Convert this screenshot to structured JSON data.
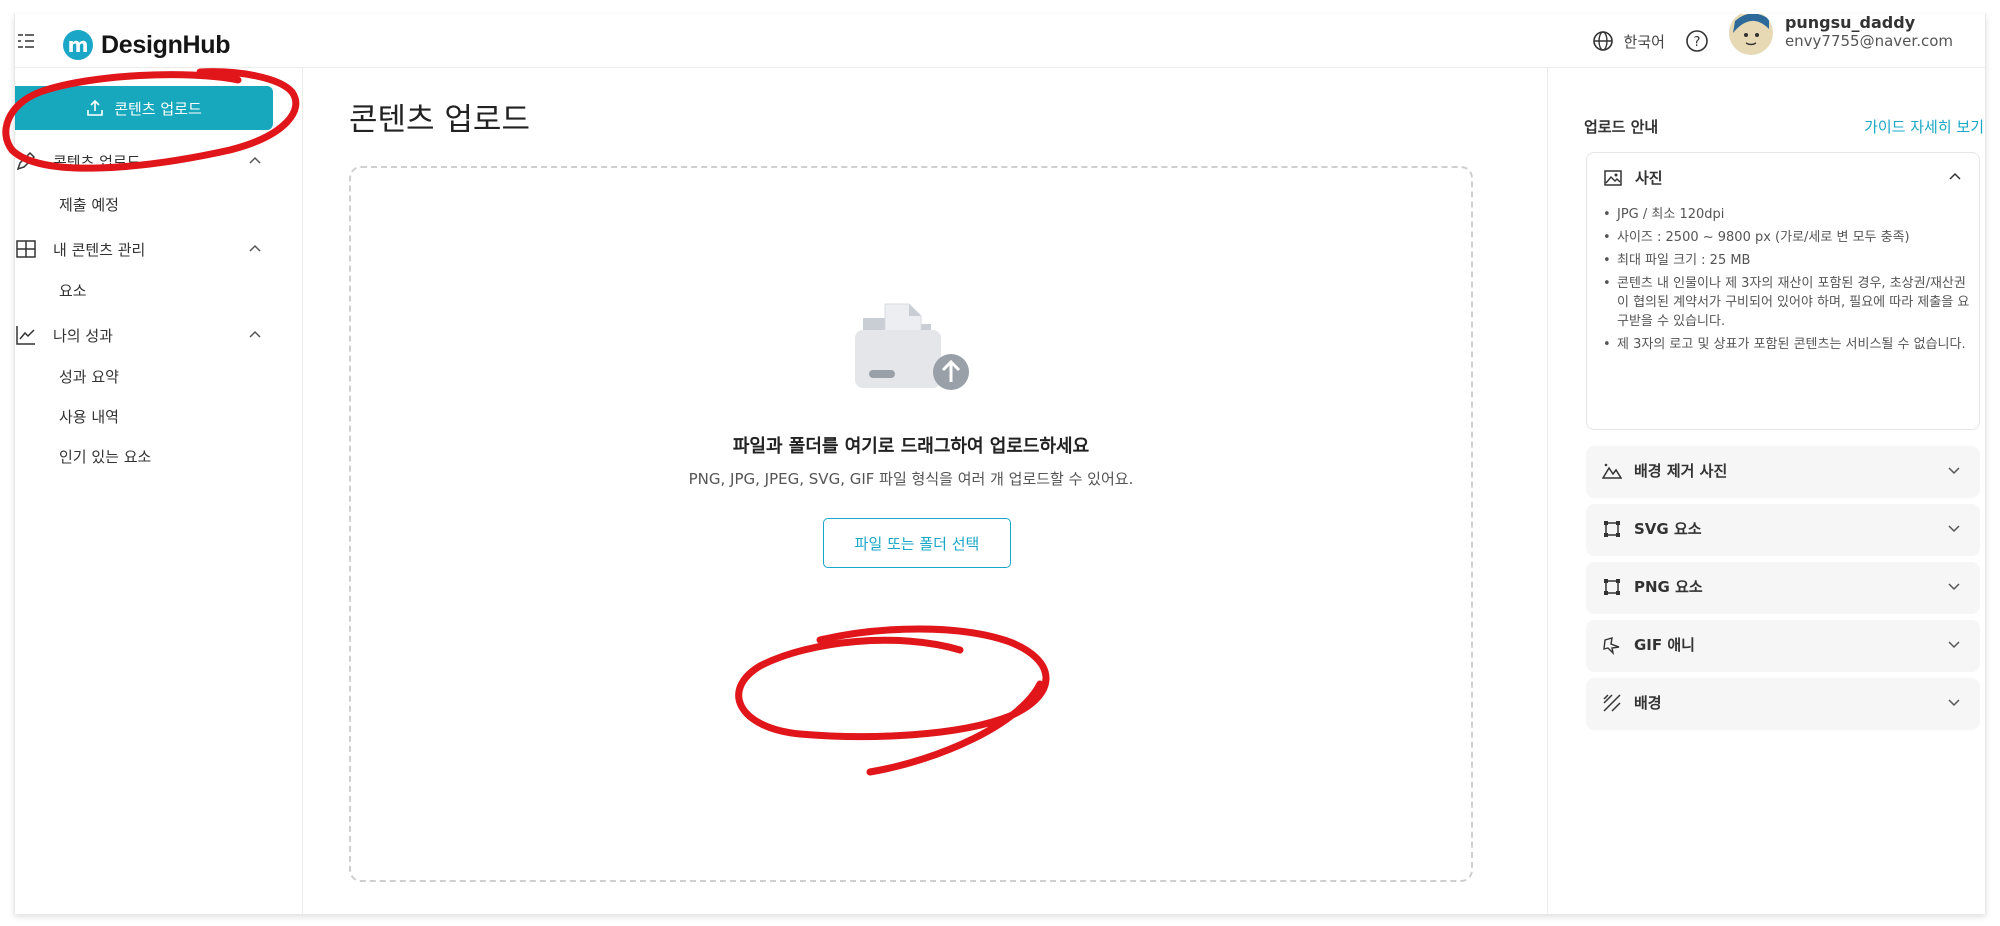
{
  "app": {
    "logo_letter": "m",
    "logo_name": "DesignHub"
  },
  "topbar": {
    "language": "한국어",
    "user_name": "pungsu_daddy",
    "user_email": "envy7755@naver.com"
  },
  "sidebar": {
    "upload_button": "콘텐츠 업로드",
    "sections": [
      {
        "label": "콘텐츠 업로드",
        "icon": "pencil-icon",
        "items": [
          "제출 예정"
        ]
      },
      {
        "label": "내 콘텐츠 관리",
        "icon": "grid-icon",
        "items": [
          "요소"
        ]
      },
      {
        "label": "나의 성과",
        "icon": "chart-line-icon",
        "items": [
          "성과 요약",
          "사용 내역",
          "인기 있는 요소"
        ]
      }
    ]
  },
  "main": {
    "title": "콘텐츠 업로드",
    "drop_title": "파일과 폴더를 여기로 드래그하여 업로드하세요",
    "drop_subtitle": "PNG, JPG, JPEG, SVG, GIF 파일 형식을 여러 개 업로드할 수 있어요.",
    "select_button": "파일 또는 폴더 선택"
  },
  "guide": {
    "title": "업로드 안내",
    "link": "가이드 자세히 보기",
    "photo": {
      "label": "사진",
      "rules": [
        "JPG / 최소 120dpi",
        "사이즈 : 2500 ~ 9800 px (가로/세로 변 모두 충족)",
        "최대 파일 크기 : 25 MB",
        "콘텐츠 내 인물이나 제 3자의 재산이 포함된 경우, 초상권/재산권이 협의된 계약서가 구비되어 있어야 하며, 필요에 따라 제출을 요구받을 수 있습니다.",
        "제 3자의 로고 및 상표가 포함된 콘텐츠는 서비스될 수 없습니다."
      ]
    },
    "categories": [
      {
        "label": "배경 제거 사진",
        "icon": "mountain-icon"
      },
      {
        "label": "SVG 요소",
        "icon": "vector-icon"
      },
      {
        "label": "PNG 요소",
        "icon": "vector-icon"
      },
      {
        "label": "GIF 애니",
        "icon": "sparkle-icon"
      },
      {
        "label": "배경",
        "icon": "pattern-icon"
      }
    ]
  },
  "colors": {
    "accent": "#18a8be",
    "annotation": "#e0161b"
  }
}
